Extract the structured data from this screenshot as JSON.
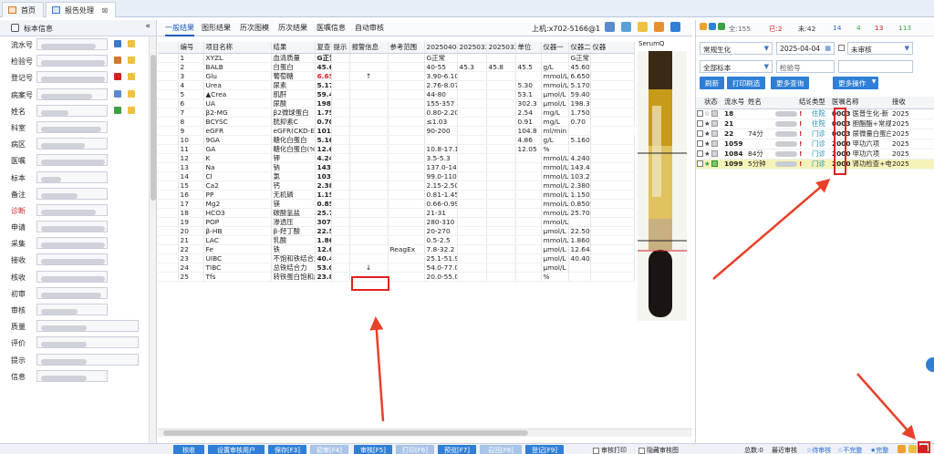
{
  "window_tabs": [
    {
      "label": "首页",
      "icon": "home-icon"
    },
    {
      "label": "报告处理",
      "icon": "report-icon",
      "close": "⊠"
    }
  ],
  "left_panel": {
    "title": "标本信息",
    "collapse": "«",
    "fields": [
      "流水号",
      "检验号",
      "登记号",
      "病案号",
      "姓名",
      "科室",
      "病区",
      "医嘱",
      "标本",
      "备注",
      "诊断",
      "申请",
      "采集",
      "接收",
      "核收",
      "初审",
      "审核",
      "质量",
      "评价",
      "提示",
      "信息"
    ]
  },
  "center": {
    "tabs": [
      "一般结果",
      "图形结果",
      "历次图模",
      "历次结果",
      "医嘱信息",
      "自动审核"
    ],
    "instrument": "上机:x702-5166@1",
    "columns": [
      "编号",
      "项目名称",
      "结果",
      "复查",
      "提示",
      "报警信息",
      "参考范围",
      "20250404",
      "20250321",
      "20250321",
      "单位",
      "仪器一",
      "仪器二",
      "仪器"
    ],
    "rows": [
      [
        "1",
        "XYZL",
        "血清质量",
        "G正常",
        "",
        "",
        "",
        "G正常",
        "",
        "",
        "",
        "",
        "G正常",
        ""
      ],
      [
        "2",
        "BALB",
        "白蛋白",
        "45.6",
        "",
        "",
        "",
        "40-55",
        "45.3",
        "45.8",
        "45.5",
        "g/L",
        "45.600",
        ""
      ],
      [
        "3",
        "Glu",
        "葡萄糖",
        "6.65",
        "",
        "↑",
        "",
        "3.90-6.10",
        "",
        "",
        "",
        "mmol/L",
        "6.650",
        ""
      ],
      [
        "4",
        "Urea",
        "尿素",
        "5.17",
        "",
        "",
        "",
        "2.76-8.07",
        "",
        "",
        "5.30",
        "mmol/L",
        "5.170",
        ""
      ],
      [
        "5",
        "▲Crea",
        "肌酐",
        "59.4",
        "",
        "",
        "",
        "44-80",
        "",
        "",
        "53.1",
        "µmol/L",
        "59.400",
        ""
      ],
      [
        "6",
        "UA",
        "尿酸",
        "198.3",
        "",
        "",
        "",
        "155-357",
        "",
        "",
        "302.3",
        "µmol/L",
        "198.30",
        ""
      ],
      [
        "7",
        "β2-MG",
        "β2微球蛋白",
        "1.75",
        "",
        "",
        "",
        "0.80-2.20",
        "",
        "",
        "2.54",
        "mg/L",
        "1.750",
        ""
      ],
      [
        "8",
        "BCYSC",
        "胱抑素C",
        "0.70",
        "",
        "",
        "",
        "≤1.03",
        "",
        "",
        "0.91",
        "mg/L",
        "0.70",
        ""
      ],
      [
        "9",
        "eGFR",
        "eGFR(CKD-EPI肌酐2",
        "101.0",
        "",
        "",
        "",
        "90-200",
        "",
        "",
        "104.8",
        "ml/min",
        ""
      ],
      [
        "10",
        "9GA",
        "糖化白蛋白",
        "5.16",
        "",
        "",
        "",
        "",
        "",
        "",
        "4.86",
        "g/L",
        "5.160",
        ""
      ],
      [
        "11",
        "GA",
        "糖化白蛋白(%)",
        "12.65",
        "",
        "",
        "",
        "10.8-17.1",
        "",
        "",
        "12.05",
        "%",
        "",
        ""
      ],
      [
        "12",
        "K",
        "钾",
        "4.24",
        "",
        "",
        "",
        "3.5-5.3",
        "",
        "",
        "",
        "mmol/L",
        "4.240",
        ""
      ],
      [
        "13",
        "Na",
        "钠",
        "143.4",
        "",
        "",
        "",
        "137.0-147.0",
        "",
        "",
        "",
        "mmol/L",
        "143.40",
        ""
      ],
      [
        "14",
        "Cl",
        "氯",
        "103.2",
        "",
        "",
        "",
        "99.0-110.0",
        "",
        "",
        "",
        "mmol/L",
        "103.20",
        ""
      ],
      [
        "15",
        "Ca2",
        "钙",
        "2.38",
        "",
        "",
        "",
        "2.15-2.50",
        "",
        "",
        "",
        "mmol/L",
        "2.380",
        ""
      ],
      [
        "16",
        "PP",
        "无机磷",
        "1.15",
        "",
        "",
        "",
        "0.81-1.45",
        "",
        "",
        "",
        "mmol/L",
        "1.150",
        ""
      ],
      [
        "17",
        "Mg2",
        "镁",
        "0.85",
        "",
        "",
        "",
        "0.66-0.99",
        "",
        "",
        "",
        "mmol/L",
        "0.850",
        ""
      ],
      [
        "18",
        "HCO3",
        "碳酸氢盐",
        "25.7",
        "",
        "",
        "",
        "21-31",
        "",
        "",
        "",
        "mmol/L",
        "25.700",
        ""
      ],
      [
        "19",
        "POP",
        "渗透压",
        "307.1",
        "",
        "",
        "",
        "280-310",
        "",
        "",
        "",
        "mmol/L",
        "",
        ""
      ],
      [
        "20",
        "β-HB",
        "β-羟丁酸",
        "22.5",
        "",
        "",
        "",
        "20-270",
        "",
        "",
        "",
        "µmol/L",
        "22.50",
        ""
      ],
      [
        "21",
        "LAC",
        "乳酸",
        "1.86",
        "",
        "",
        "",
        "0.5-2.5",
        "",
        "",
        "",
        "mmol/L",
        "1.860",
        ""
      ],
      [
        "22",
        "Fe",
        "铁",
        "12.64",
        "",
        "",
        "ReagEx",
        "7.8-32.2",
        "",
        "",
        "",
        "µmol/L",
        "12.640",
        ""
      ],
      [
        "23",
        "UIBC",
        "不饱和铁结合力",
        "40.40",
        "",
        "",
        "",
        "25.1-51.9",
        "",
        "",
        "",
        "µmol/L",
        "40.400",
        ""
      ],
      [
        "24",
        "TIBC",
        "总铁结合力",
        "53.0",
        "",
        "↓",
        "",
        "54.0-77.0",
        "",
        "",
        "",
        "µmol/L",
        "",
        ""
      ],
      [
        "25",
        "Tfs",
        "转铁蛋白饱和度",
        "23.8",
        "",
        "",
        "",
        "20.0-55.0",
        "",
        "",
        "",
        "%",
        "",
        ""
      ]
    ],
    "tube_label": "SerumQ"
  },
  "right_panel": {
    "stats": [
      {
        "label": "全:155",
        "color": "#666"
      },
      {
        "label": "已:2",
        "color": "#d02020"
      },
      {
        "label": "未:42",
        "color": "#333"
      },
      {
        "label": "14",
        "color": "#2a6ad8"
      },
      {
        "label": "4",
        "color": "#3aa040"
      },
      {
        "label": "13",
        "color": "#d02020"
      },
      {
        "label": "113",
        "color": "#3aa040"
      }
    ],
    "filter1": "常规生化",
    "date": "2025-04-04",
    "status_filter": "未审核",
    "filter2": "全部标本",
    "search_placeholder": "检验号",
    "buttons": [
      "刷新",
      "打印刷选",
      "更多查询",
      "更多操作"
    ],
    "columns": [
      "状态",
      "流水号",
      "姓名",
      "类型",
      "结论",
      "医嘱名称",
      "接收"
    ],
    "rows": [
      {
        "id": "18",
        "age": "",
        "type": "住院",
        "code": "0003",
        "order": "医普生化-新",
        "recv": "2025"
      },
      {
        "id": "21",
        "age": "",
        "type": "住院",
        "code": "0003",
        "order": "胆酯酯+常规生",
        "recv": "2025"
      },
      {
        "id": "22",
        "age": "74分",
        "type": "门诊",
        "code": "0003",
        "order": "尿微量白蛋白/",
        "recv": "2025"
      },
      {
        "id": "1059",
        "age": "",
        "type": "门诊",
        "code": "2000",
        "order": "甲功六项",
        "recv": "2025"
      },
      {
        "id": "1084",
        "age": "84分",
        "type": "门诊",
        "code": "2000",
        "order": "甲功六项",
        "recv": "2025"
      },
      {
        "id": "1099",
        "age": "5分钟",
        "type": "门诊",
        "code": "2000",
        "order": "肾功检查+电解",
        "recv": "2025"
      }
    ]
  },
  "bottom_bar": {
    "buttons": [
      "核收",
      "设置审核用户",
      "保存[F3]",
      "初审[F4]",
      "审核[F5]",
      "打印[F6]",
      "预览[F7]",
      "召回[F8]",
      "登记[F9]"
    ],
    "checks": [
      "审核打印",
      "隐藏审核图"
    ],
    "status": {
      "count": "总数:0",
      "mode": "最近审核",
      "a": "☆待审核",
      "b": "☆不完整",
      "c": "★完整"
    }
  }
}
